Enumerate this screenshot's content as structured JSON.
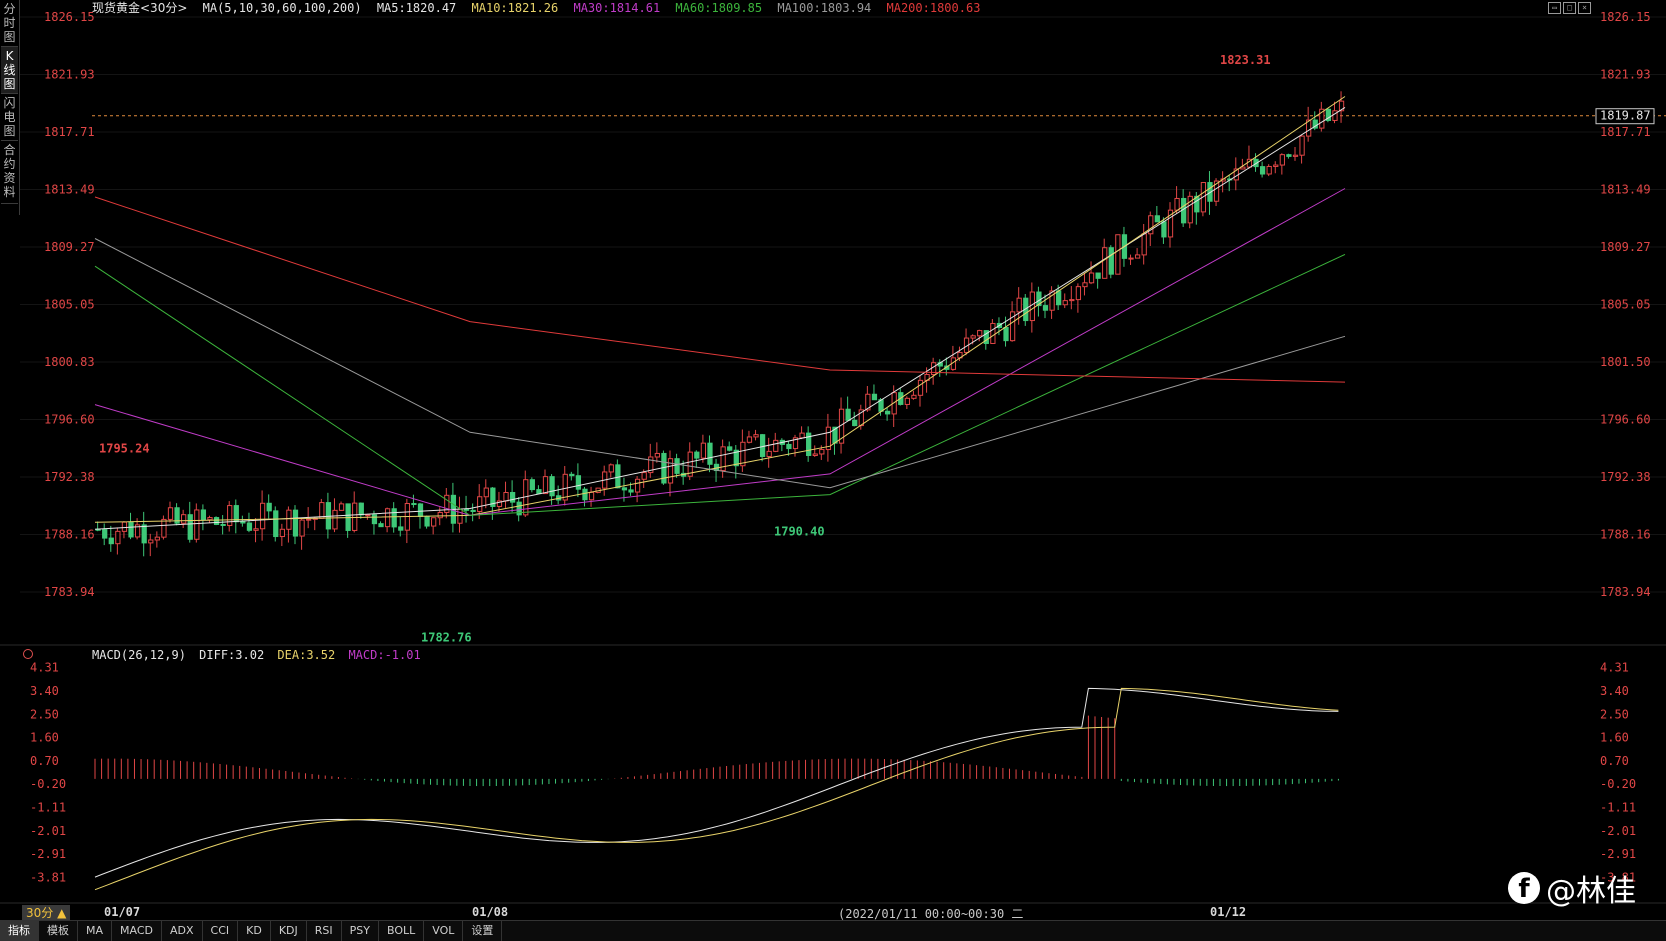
{
  "side_tabs": [
    "分时图",
    "K线图",
    "闪电图",
    "合约资料"
  ],
  "side_tab_active": 1,
  "header": {
    "title": "现货黄金<30分>",
    "ma_params": "MA(5,10,30,60,100,200)",
    "ma_values": [
      {
        "label": "MA5:1820.47",
        "color": "#e6e6e6"
      },
      {
        "label": "MA10:1821.26",
        "color": "#e8d36a"
      },
      {
        "label": "MA30:1814.61",
        "color": "#c03cc8"
      },
      {
        "label": "MA60:1809.85",
        "color": "#3cb43c"
      },
      {
        "label": "MA100:1803.94",
        "color": "#9a9a9a"
      },
      {
        "label": "MA200:1800.63",
        "color": "#e03a3a"
      }
    ]
  },
  "price_axis": {
    "ticks": [
      "1826.15",
      "1821.93",
      "1817.71",
      "1813.49",
      "1809.27",
      "1805.05",
      "1800.83",
      "1796.60",
      "1792.38",
      "1788.16",
      "1783.94"
    ],
    "right_ticks": [
      "1826.15",
      "1821.93",
      "1817.71",
      "1813.49",
      "1809.27",
      "1805.05",
      "1801.50",
      "1796.60",
      "1792.38",
      "1788.16",
      "1783.94"
    ],
    "current_price": "1819.87",
    "color": "#e04646"
  },
  "annotations": {
    "high_left": "1795.24",
    "low_main": "1782.76",
    "low_mid": "1790.40",
    "high_main": "1823.31"
  },
  "macd_header": {
    "params": "MACD(26,12,9)",
    "diff": "DIFF:3.02",
    "dea": "DEA:3.52",
    "macd": "MACD:-1.01"
  },
  "macd_axis": {
    "ticks": [
      "4.31",
      "3.40",
      "2.50",
      "1.60",
      "0.70",
      "-0.20",
      "-1.11",
      "-2.01",
      "-2.91",
      "-3.81"
    ]
  },
  "x_axis": {
    "dates": [
      "01/07",
      "01/08",
      "01/12"
    ],
    "cursor_time": "(2022/01/11 00:00~00:30 二"
  },
  "period_button": "30分 ▲",
  "bottom_tabs": [
    "指标",
    "模板",
    "MA",
    "MACD",
    "ADX",
    "CCI",
    "KD",
    "KDJ",
    "RSI",
    "PSY",
    "BOLL",
    "VOL",
    "设置"
  ],
  "bottom_tab_active": 0,
  "watermark": "@林佳",
  "colors": {
    "up": "#e04646",
    "down": "#3ec878",
    "background": "#000000"
  },
  "chart_data": {
    "type": "line",
    "title": "现货黄金<30分>",
    "ylim": [
      1782.0,
      1827.0
    ],
    "x": [
      "01/07",
      "01/08",
      "01/11",
      "01/12"
    ],
    "series": [
      {
        "name": "MA5",
        "values": [
          1790.0,
          1791.5,
          1797.0,
          1820.47
        ]
      },
      {
        "name": "MA10",
        "values": [
          1790.5,
          1791.0,
          1796.0,
          1821.26
        ]
      },
      {
        "name": "MA30",
        "values": [
          1799.0,
          1791.0,
          1794.0,
          1814.61
        ]
      },
      {
        "name": "MA60",
        "values": [
          1809.0,
          1791.0,
          1792.5,
          1809.85
        ]
      },
      {
        "name": "MA100",
        "values": [
          1811.0,
          1797.0,
          1793.0,
          1803.94
        ]
      },
      {
        "name": "MA200",
        "values": [
          1814.0,
          1805.0,
          1801.5,
          1800.63
        ]
      }
    ],
    "macd": {
      "diff": 3.02,
      "dea": 3.52,
      "macd": -1.01,
      "ylim": [
        -4.3,
        4.6
      ]
    }
  }
}
